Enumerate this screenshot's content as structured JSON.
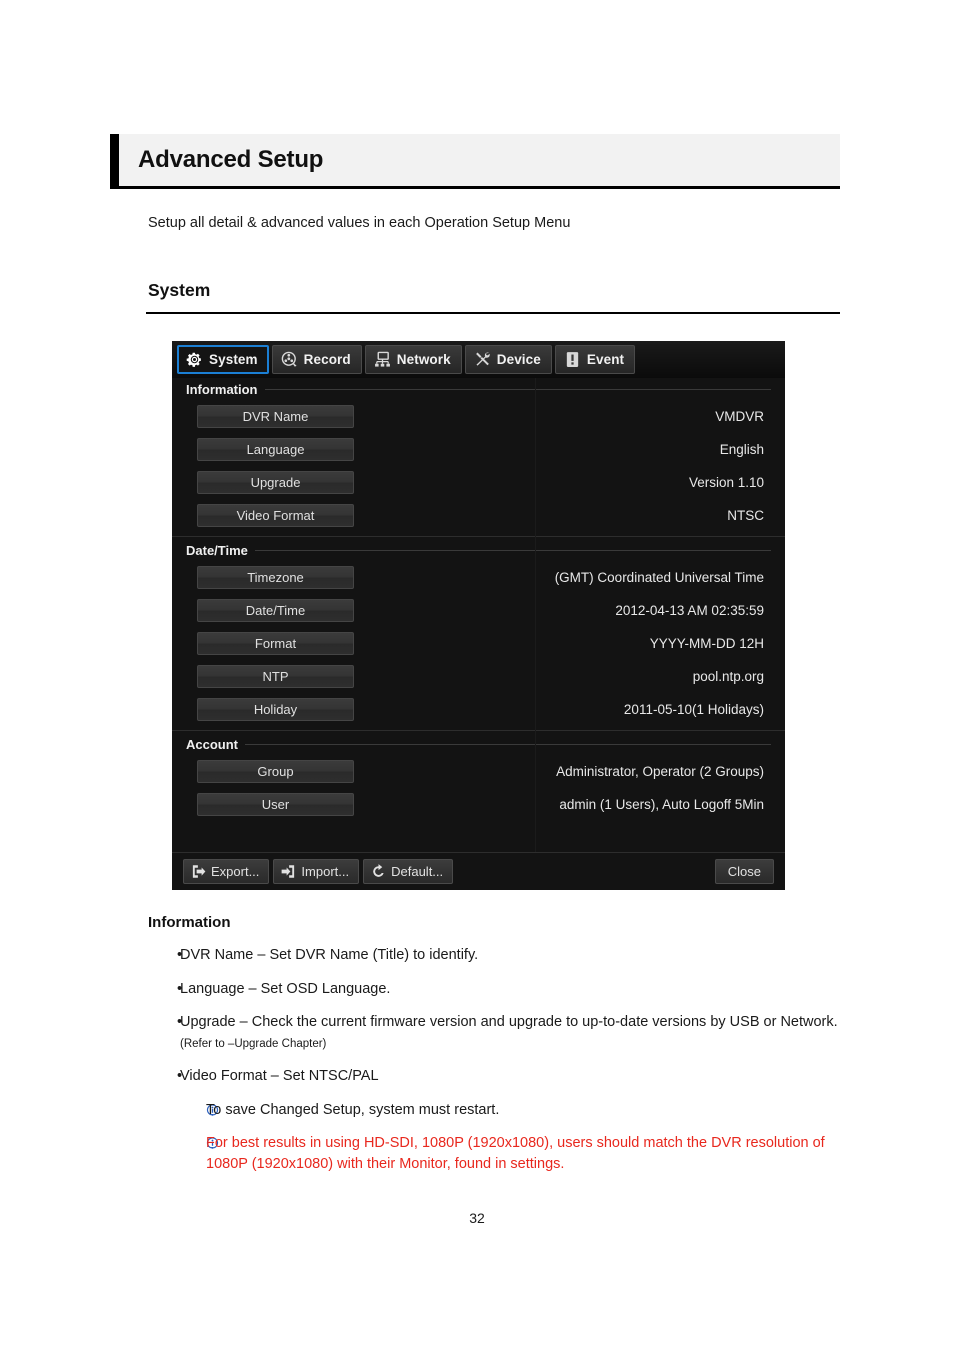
{
  "document": {
    "chapter_title": "Advanced Setup",
    "intro": "Setup all detail & advanced values in each Operation Setup Menu",
    "section_heading": "System",
    "page_number": "32",
    "accent_color": "#000000",
    "warning_color": "#e8281e",
    "info_icon_color": "#2a5fbe"
  },
  "dvr": {
    "tabs": [
      {
        "label": "System",
        "icon": "gear-icon",
        "active": true
      },
      {
        "label": "Record",
        "icon": "reel-icon",
        "active": false
      },
      {
        "label": "Network",
        "icon": "network-icon",
        "active": false
      },
      {
        "label": "Device",
        "icon": "tools-icon",
        "active": false
      },
      {
        "label": "Event",
        "icon": "alert-icon",
        "active": false
      }
    ],
    "active_tab_border_color": "#1b7fd4",
    "groups": [
      {
        "title": "Information",
        "rows": [
          {
            "label": "DVR Name",
            "value": "VMDVR"
          },
          {
            "label": "Language",
            "value": "English"
          },
          {
            "label": "Upgrade",
            "value": "Version 1.10"
          },
          {
            "label": "Video Format",
            "value": "NTSC"
          }
        ]
      },
      {
        "title": "Date/Time",
        "rows": [
          {
            "label": "Timezone",
            "value": "(GMT) Coordinated Universal Time"
          },
          {
            "label": "Date/Time",
            "value": "2012-04-13 AM 02:35:59"
          },
          {
            "label": "Format",
            "value": "YYYY-MM-DD 12H"
          },
          {
            "label": "NTP",
            "value": "pool.ntp.org"
          },
          {
            "label": "Holiday",
            "value": "2011-05-10(1 Holidays)"
          }
        ]
      },
      {
        "title": "Account",
        "rows": [
          {
            "label": "Group",
            "value": "Administrator, Operator (2 Groups)"
          },
          {
            "label": "User",
            "value": "admin (1 Users), Auto Logoff 5Min"
          }
        ]
      }
    ],
    "footer": {
      "buttons": [
        {
          "label": "Export...",
          "icon": "export-icon"
        },
        {
          "label": "Import...",
          "icon": "import-icon"
        },
        {
          "label": "Default...",
          "icon": "refresh-icon"
        }
      ],
      "close_label": "Close"
    }
  },
  "body": {
    "sub_heading": "Information",
    "bullets": [
      {
        "text": "DVR Name – Set DVR Name (Title) to identify.",
        "note": ""
      },
      {
        "text": "Language – Set OSD Language.",
        "note": ""
      },
      {
        "text": "Upgrade – Check the current firmware version and upgrade to up-to-date versions by USB or Network.",
        "note": "(Refer to –Upgrade Chapter)"
      },
      {
        "text": "Video Format – Set NTSC/PAL",
        "note": ""
      }
    ],
    "notes": [
      {
        "text": "To save Changed Setup, system must restart.",
        "warn": false
      },
      {
        "text": "For best results in using HD-SDI, 1080P (1920x1080), users should match the DVR resolution of 1080P (1920x1080) with their Monitor, found in settings.",
        "warn": true
      }
    ]
  }
}
